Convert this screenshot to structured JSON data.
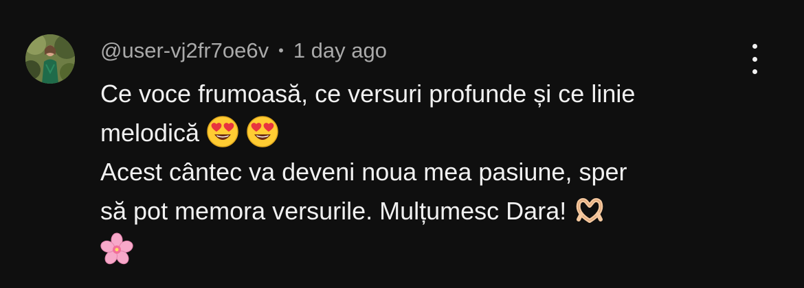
{
  "comment": {
    "username": "@user-vj2fr7oe6v",
    "separator": "•",
    "timestamp": "1 day ago",
    "lines": [
      "Ce voce frumoasă, ce versuri profunde și ce linie",
      "melodică",
      "Acest cântec va deveni noua mea pasiune, sper",
      "să pot memora versurile. Mulțumesc Dara!"
    ],
    "emojis": {
      "line2": [
        "heart-eyes-emoji",
        "heart-eyes-emoji"
      ],
      "line4": [
        "heart-hands-emoji"
      ],
      "line5": [
        "cherry-blossom-emoji"
      ]
    }
  },
  "colors": {
    "background": "#0f0f0f",
    "text_primary": "#f1f1f1",
    "text_secondary": "#aaaaaa",
    "emoji_face": "#ffcc33",
    "emoji_heart": "#e8343f",
    "flower": "#f7a8c9"
  }
}
